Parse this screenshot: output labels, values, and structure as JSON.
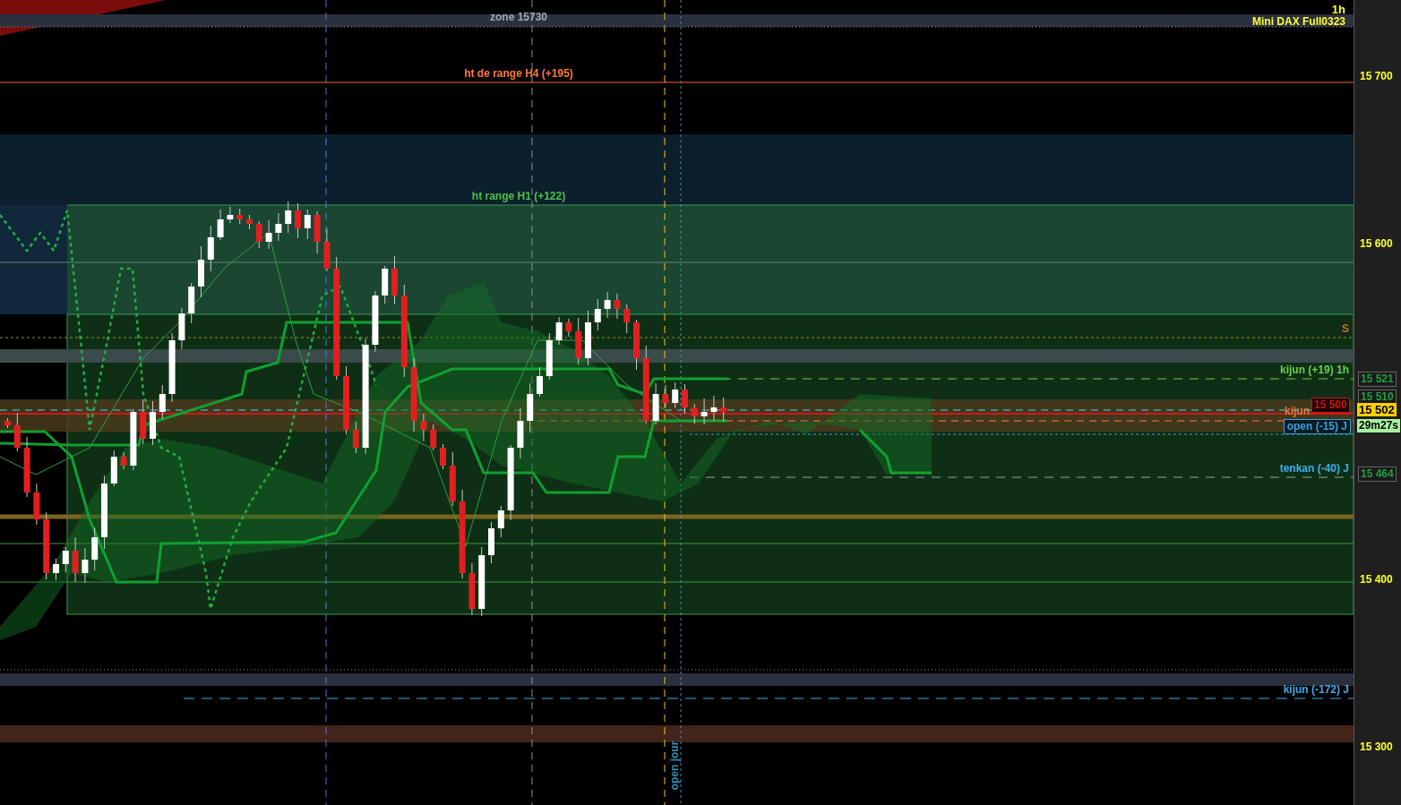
{
  "chart": {
    "timeframe": "1h",
    "instrument": "Mini DAX Full0323",
    "price_axis": [
      "15 700",
      "15 600",
      "15 400",
      "15 300"
    ],
    "line_labels": [
      {
        "text": "zone 15730",
        "color": "#a0a8b4",
        "kind": "plain"
      },
      {
        "text": "ht de range H4 (+195)",
        "color": "#ff7a3c",
        "kind": "plain"
      },
      {
        "text": "ht range H1 (+122)",
        "color": "#4cc44c",
        "kind": "plain"
      },
      {
        "text": "S",
        "color": "#8f8f2a",
        "kind": "plain"
      },
      {
        "text": "kijun (+19) 1h",
        "color": "#6ccf4a",
        "kind": "plain"
      },
      {
        "text": "kijun",
        "color": "#e07a40",
        "kind": "plain"
      },
      {
        "text": "open (-15) J",
        "color": "#3aa0e0",
        "kind": "boxed"
      },
      {
        "text": "tenkan (-40) J",
        "color": "#3ab0f0",
        "kind": "plain"
      },
      {
        "text": "kijun (-172) J",
        "color": "#3ab0f0",
        "kind": "plain"
      }
    ],
    "price_tags": [
      {
        "text": "15 521",
        "kind": "level"
      },
      {
        "text": "15 510",
        "kind": "level"
      },
      {
        "text": "15 500",
        "kind": "alert"
      },
      {
        "text": "15 502",
        "kind": "last"
      },
      {
        "text": "29m27s",
        "kind": "timer"
      },
      {
        "text": "15 464",
        "kind": "level"
      }
    ],
    "vertical_label": "open jour"
  }
}
